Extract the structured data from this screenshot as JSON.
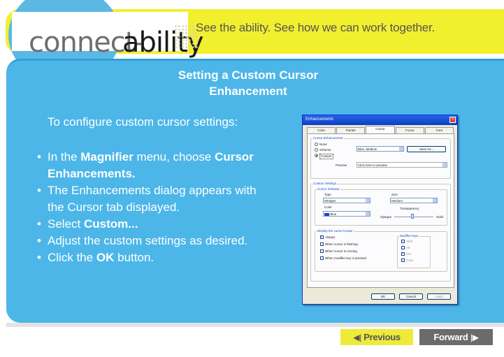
{
  "header": {
    "brand_connect": "connect-",
    "brand_ability": "ability",
    "tagline": "See the ability. See how we can work together."
  },
  "slide": {
    "title": "Setting a Custom Cursor Enhancement",
    "intro": "To configure custom cursor settings:",
    "steps": [
      {
        "pre": "In the ",
        "bold": "Magnifier",
        "post": " menu, choose ",
        "bold2": "Cursor Enhancements."
      },
      {
        "text": "The Enhancements dialog appears with the Cursor tab displayed."
      },
      {
        "pre": "Select ",
        "bold": "Custom..."
      },
      {
        "text": "Adjust the custom settings as desired."
      },
      {
        "pre": "Click the ",
        "bold": "OK",
        "post": " button."
      }
    ]
  },
  "dialog": {
    "title": "Enhancements",
    "tabs": [
      "Color",
      "Pointer",
      "Cursor",
      "Focus",
      "Font"
    ],
    "active_tab": "Cursor",
    "cursor_enhancement_label": "Cursor Enhancement",
    "radio_none": "None",
    "radio_scheme": "Scheme",
    "radio_custom": "Custom",
    "scheme_value": "Blue, Medium",
    "save_button": "Save As...",
    "preview_label": "Preview",
    "preview_value": "Click here to preview",
    "custom_settings_label": "Custom Settings",
    "cursor_indicator_label": "Cursor indicator",
    "type_label": "Type",
    "type_value": "Wedges",
    "size_label": "Size",
    "size_value": "Medium",
    "color_label": "Color",
    "color_value": "Blue",
    "transparency_label": "Transparency",
    "opaque_label": "Opaque",
    "solid_label": "Solid",
    "display_label": "Display the cursor locator",
    "display_options": [
      "Always",
      "When cursor is flashing",
      "When cursor is moving",
      "When modifier key is pressed"
    ],
    "modifier_label": "Modifier keys",
    "modifier_keys": [
      "Shift",
      "Alt",
      "Ctrl",
      "Caps"
    ],
    "ok": "OK",
    "cancel": "Cancel",
    "apply": "Apply"
  },
  "nav": {
    "previous": "Previous",
    "forward": "Forward"
  },
  "colors": {
    "panel": "#4cb6e8",
    "band": "#f2ef2e",
    "prev_button": "#eeea3a",
    "forward_button": "#6b6b6b"
  }
}
